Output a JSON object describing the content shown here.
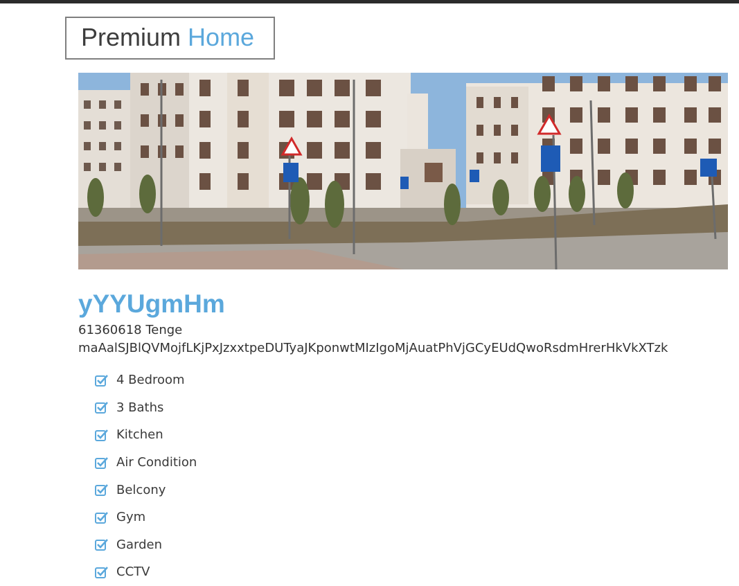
{
  "header": {
    "logo_word1": "Premium",
    "logo_word2": "Home"
  },
  "listing": {
    "title": "yYYUgmHm",
    "price": "61360618 Tenge",
    "description": "maAalSJBlQVMojfLKjPxJzxxtpeDUTyaJKponwtMIzIgoMjAuatPhVjGCyEUdQwoRsdmHrerHkVkXTzk",
    "features": [
      {
        "label": "4 Bedroom"
      },
      {
        "label": "3 Baths"
      },
      {
        "label": "Kitchen"
      },
      {
        "label": "Air Condition"
      },
      {
        "label": "Belcony"
      },
      {
        "label": "Gym"
      },
      {
        "label": "Garden"
      },
      {
        "label": "CCTV"
      }
    ]
  },
  "colors": {
    "accent": "#5ba8dc",
    "text": "#333333",
    "topbar": "#2b2b2b"
  }
}
